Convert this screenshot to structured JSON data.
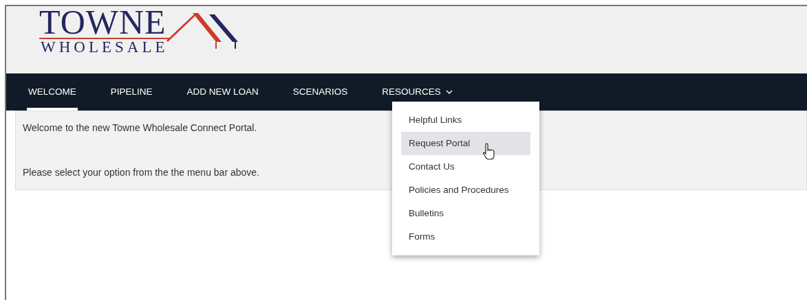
{
  "logo": {
    "line_1": "TOWNE",
    "line_2": "WHOLESALE"
  },
  "nav": [
    {
      "label": "WELCOME",
      "selected": true,
      "kind": "link"
    },
    {
      "label": "PIPELINE",
      "selected": false,
      "kind": "link"
    },
    {
      "label": "ADD NEW LOAN",
      "selected": false,
      "kind": "link"
    },
    {
      "label": "SCENARIOS",
      "selected": false,
      "kind": "link"
    },
    {
      "label": "RESOURCES",
      "selected": false,
      "kind": "menu"
    }
  ],
  "dropdown": [
    {
      "label": "Helpful Links",
      "selected": false
    },
    {
      "label": "Request Portal",
      "selected": true
    },
    {
      "label": "Contact Us",
      "selected": false
    },
    {
      "label": "Policies and Procedures",
      "selected": false
    },
    {
      "label": "Bulletins",
      "selected": false
    },
    {
      "label": "Forms",
      "selected": false
    }
  ],
  "content": [
    "Welcome to the new Towne Wholesale Connect Portal.",
    "Please select your option from the the menu bar above."
  ]
}
